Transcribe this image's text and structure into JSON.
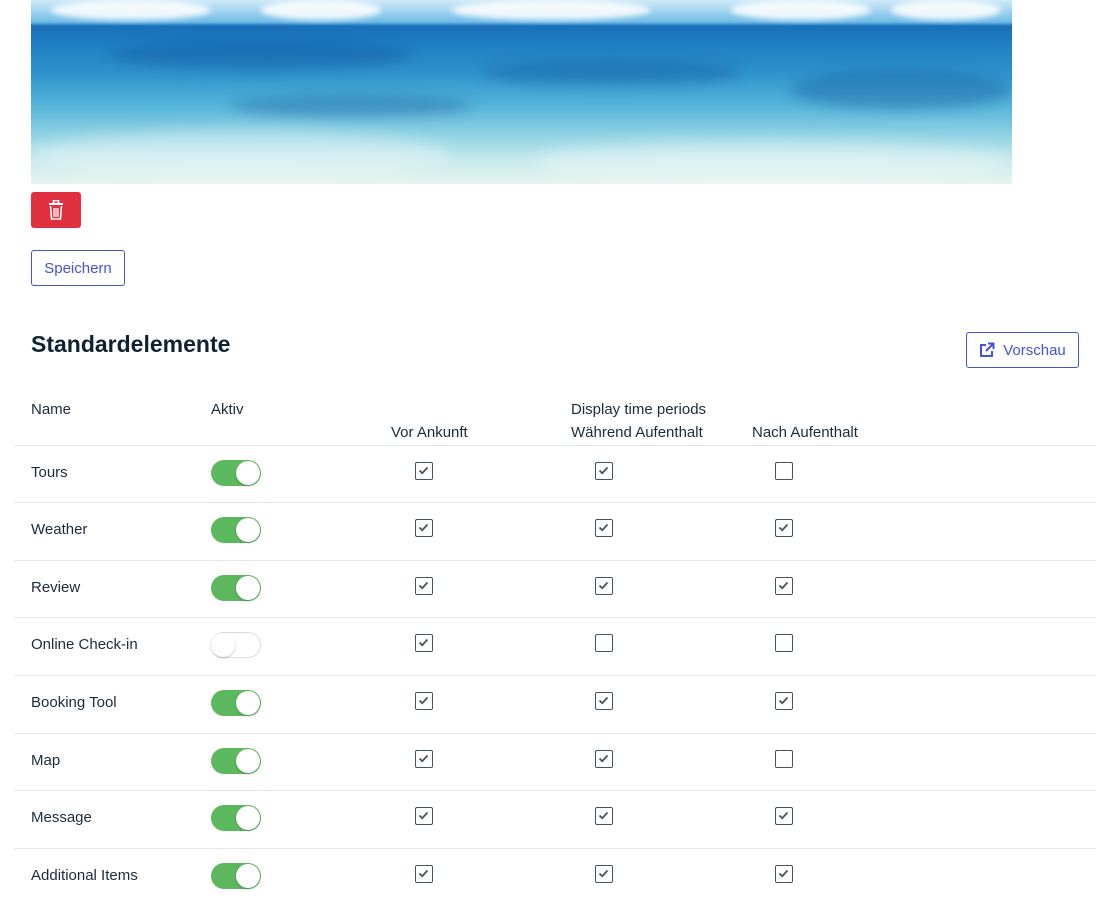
{
  "banner": {
    "image": "beach-ocean-photo"
  },
  "actions": {
    "delete_icon": "trash-icon",
    "save_label": "Speichern"
  },
  "section": {
    "title": "Standardelemente",
    "preview_label": "Vorschau",
    "preview_icon": "external-link-icon"
  },
  "table": {
    "headers": {
      "name": "Name",
      "active": "Aktiv",
      "group": "Display time periods",
      "before": "Vor Ankunft",
      "during": "Während Aufenthalt",
      "after": "Nach Aufenthalt"
    },
    "rows": [
      {
        "name": "Tours",
        "active": true,
        "before": true,
        "during": true,
        "after": false
      },
      {
        "name": "Weather",
        "active": true,
        "before": true,
        "during": true,
        "after": true
      },
      {
        "name": "Review",
        "active": true,
        "before": true,
        "during": true,
        "after": true
      },
      {
        "name": "Online Check-in",
        "active": false,
        "before": true,
        "during": false,
        "after": false
      },
      {
        "name": "Booking Tool",
        "active": true,
        "before": true,
        "during": true,
        "after": true
      },
      {
        "name": "Map",
        "active": true,
        "before": true,
        "during": true,
        "after": false
      },
      {
        "name": "Message",
        "active": true,
        "before": true,
        "during": true,
        "after": true
      },
      {
        "name": "Additional Items",
        "active": true,
        "before": true,
        "during": true,
        "after": true
      }
    ]
  },
  "colors": {
    "accent": "#4452d6",
    "danger": "#e0303f",
    "toggle_on": "#5cb85c"
  }
}
